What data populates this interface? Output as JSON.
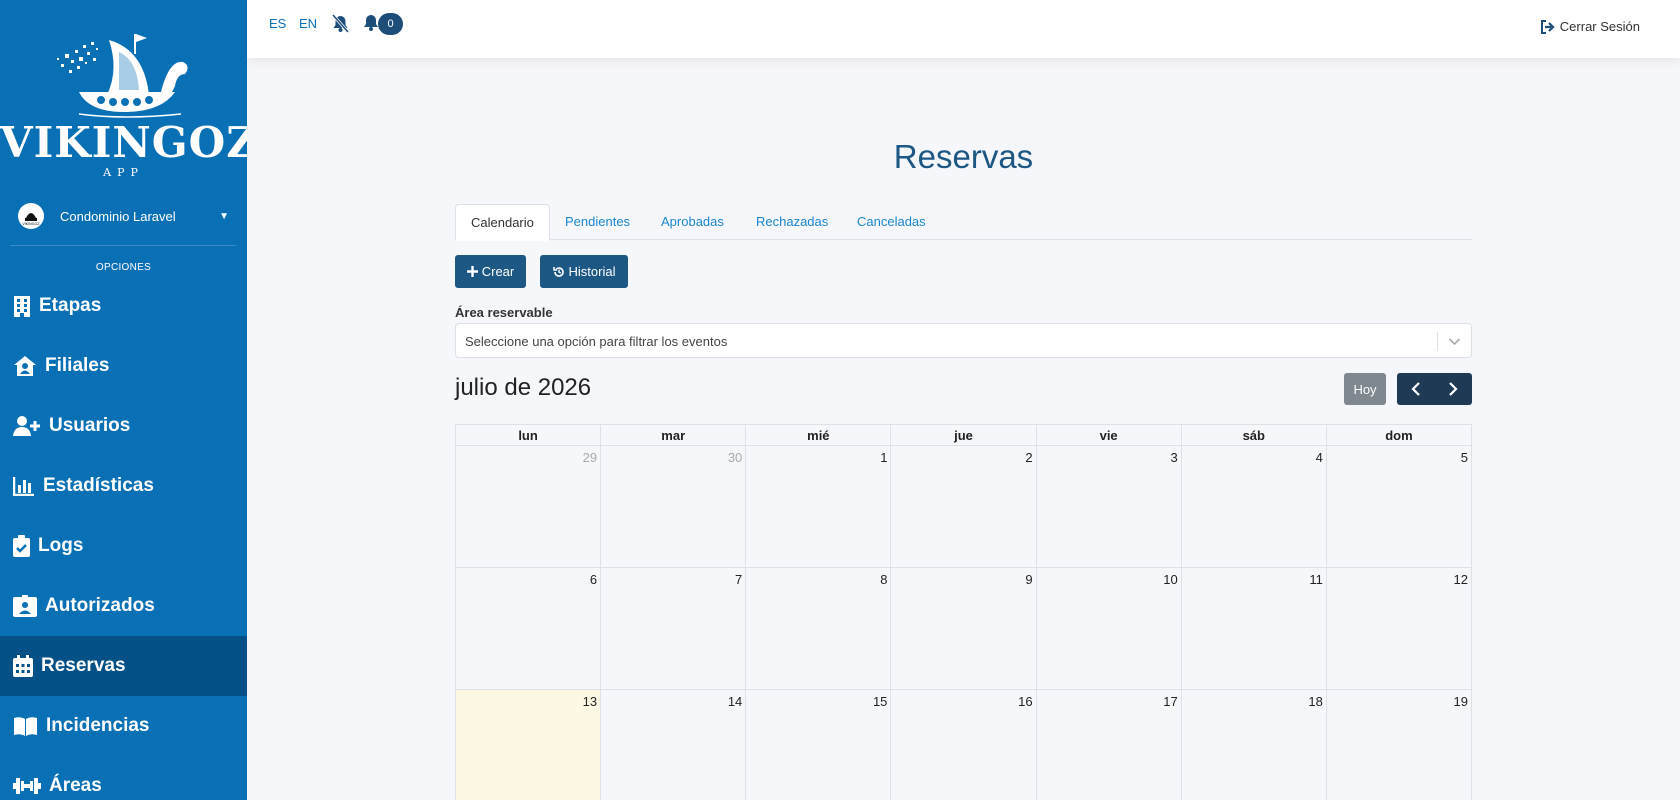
{
  "sidebar": {
    "logo_title": "VIKINGOZ",
    "logo_sub": "APP",
    "condo_avatar": "VIKINGOZ",
    "condo_name": "Condominio Laravel",
    "section_label": "OPCIONES",
    "items": [
      {
        "label": "Etapas",
        "icon": "building-icon"
      },
      {
        "label": "Filiales",
        "icon": "house-user-icon"
      },
      {
        "label": "Usuarios",
        "icon": "user-plus-icon"
      },
      {
        "label": "Estadísticas",
        "icon": "chart-bar-icon"
      },
      {
        "label": "Logs",
        "icon": "clipboard-check-icon"
      },
      {
        "label": "Autorizados",
        "icon": "id-badge-icon"
      },
      {
        "label": "Reservas",
        "icon": "calendar-icon"
      },
      {
        "label": "Incidencias",
        "icon": "book-icon"
      },
      {
        "label": "Áreas",
        "icon": "dumbbell-icon"
      }
    ],
    "active_item": "Reservas"
  },
  "topbar": {
    "lang_es": "ES",
    "lang_en": "EN",
    "notif_count": "0",
    "logout": "Cerrar Sesión"
  },
  "main": {
    "title": "Reservas",
    "tabs": [
      "Calendario",
      "Pendientes",
      "Aprobadas",
      "Rechazadas",
      "Canceladas"
    ],
    "active_tab": "Calendario",
    "create_label": "Crear",
    "history_label": "Historial",
    "area_label": "Área reservable",
    "area_placeholder": "Seleccione una opción para filtrar los eventos"
  },
  "calendar": {
    "month_title": "julio de 2026",
    "today_label": "Hoy",
    "weekdays": [
      "lun",
      "mar",
      "mié",
      "jue",
      "vie",
      "sáb",
      "dom"
    ],
    "weeks": [
      [
        "29",
        "30",
        "1",
        "2",
        "3",
        "4",
        "5"
      ],
      [
        "6",
        "7",
        "8",
        "9",
        "10",
        "11",
        "12"
      ],
      [
        "13",
        "14",
        "15",
        "16",
        "17",
        "18",
        "19"
      ]
    ],
    "today_day": "13",
    "accent_color": "#1d5784",
    "sidebar_color": "#0a70b6"
  }
}
